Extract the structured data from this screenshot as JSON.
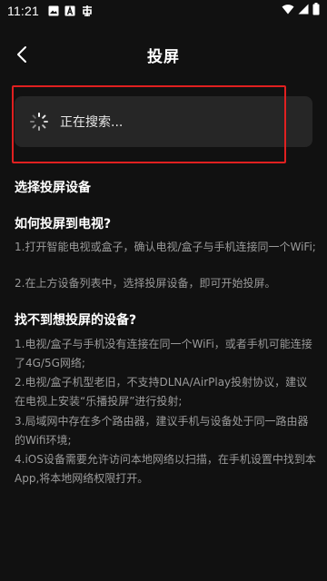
{
  "status_bar": {
    "time": "11:21",
    "left_icons": [
      "image-icon",
      "a-box-icon",
      "app-icon"
    ],
    "right_icons": [
      "wifi-icon",
      "signal-icon",
      "battery-icon"
    ]
  },
  "nav": {
    "title": "投屏"
  },
  "search": {
    "status_text": "正在搜索..."
  },
  "help": {
    "select_title": "选择投屏设备",
    "how_title": "如何投屏到电视?",
    "how_steps": [
      "1.打开智能电视或盒子，确认电视/盒子与手机连接同一个WiFi;",
      "2.在上方设备列表中，选择投屏设备，即可开始投屏。"
    ],
    "notfound_title": "找不到想投屏的设备?",
    "notfound_steps": [
      "1.电视/盒子与手机没有连接在同一个WiFi，或者手机可能连接了4G/5G网络;",
      "2.电视/盒子机型老旧，不支持DLNA/AirPlay投射协议，建议在电视上安装“乐播投屏”进行投射;",
      "3.局域网中存在多个路由器，建议手机与设备处于同一路由器的Wifi环境;",
      "4.iOS设备需要允许访问本地网络以扫描，在手机设置中找到本App,将本地网络权限打开。"
    ]
  },
  "colors": {
    "background": "#111111",
    "card": "#262626",
    "highlight": "#e02020",
    "muted_text": "#9a9a9a"
  }
}
